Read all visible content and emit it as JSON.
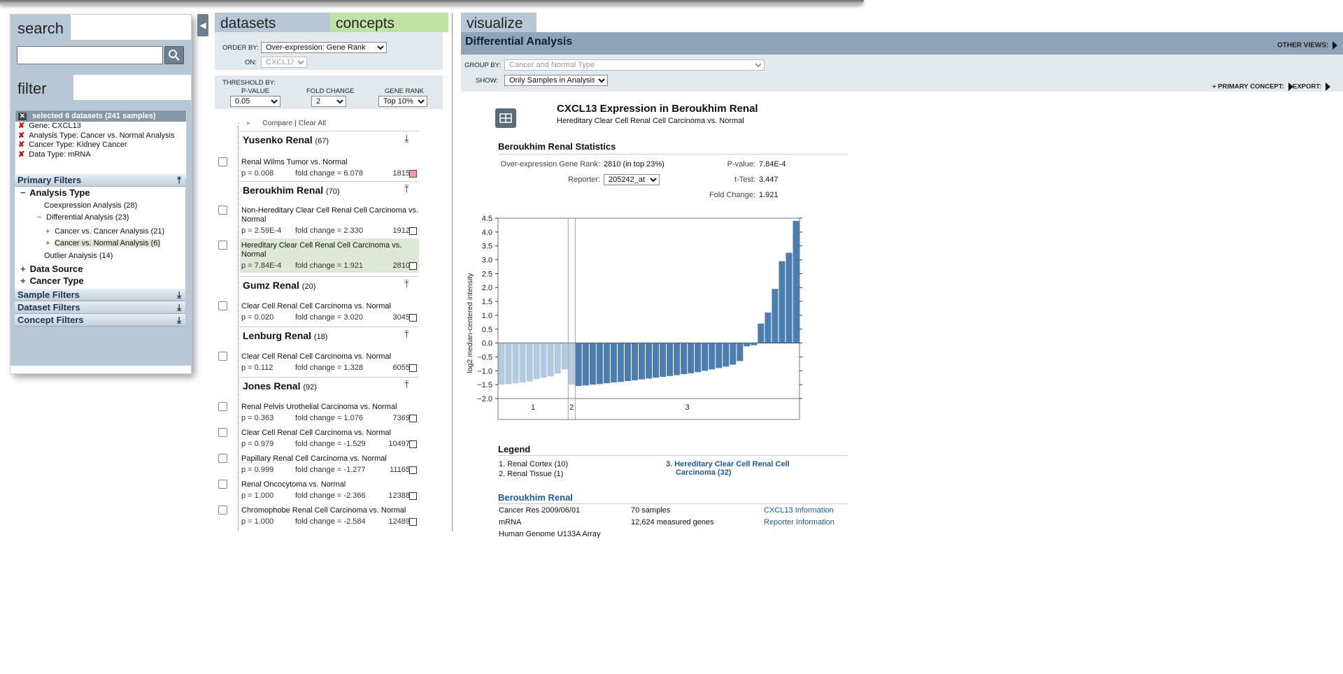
{
  "search": {
    "tab_label": "search",
    "input_value": "",
    "placeholder": ""
  },
  "filter": {
    "tab_label": "filter",
    "selected_header": "selected 6 datasets (241 samples)",
    "selected_items": [
      "Gene: CXCL13",
      "Analysis Type: Cancer vs. Normal Analysis",
      "Cancer Type: Kidney Cancer",
      "Data Type: mRNA"
    ],
    "primary_filters_label": "Primary Filters",
    "analysis_type_label": "Analysis Type",
    "coexpression": "Coexpression Analysis (28)",
    "differential": "Differential Analysis (23)",
    "cancer_vs_cancer": "Cancer vs. Cancer Analysis (21)",
    "cancer_vs_normal": "Cancer vs. Normal Analysis (6)",
    "outlier": "Outlier Analysis (14)",
    "data_source": "Data Source",
    "cancer_type": "Cancer Type",
    "sample_filters": "Sample Filters",
    "dataset_filters": "Dataset Filters",
    "concept_filters": "Concept Filters"
  },
  "middle": {
    "tab_datasets": "datasets",
    "tab_concepts": "concepts",
    "order_by_label": "ORDER BY:",
    "order_by_value": "Over-expression: Gene Rank",
    "on_label": "ON:",
    "on_value": "CXCL13",
    "threshold_label": "THRESHOLD BY:",
    "pvalue_label": "P-VALUE",
    "pvalue_value": "0.05",
    "foldchange_label": "FOLD CHANGE",
    "foldchange_value": "2",
    "generank_label": "GENE RANK",
    "generank_value": "Top 10%",
    "compare_label": "Compare",
    "sep": "|",
    "clear_all_label": "Clear All",
    "groups": [
      {
        "name": "Yusenko Renal",
        "count": "(67)",
        "items": [
          {
            "title": "Renal Wilms Tumor vs. Normal",
            "p": "p = 0.008",
            "fc": "fold change = 6.078",
            "rank": "1815"
          }
        ]
      },
      {
        "name": "Beroukhim Renal",
        "count": "(70)",
        "items": [
          {
            "title": "Non-Hereditary Clear Cell Renal Cell Carcinoma vs. Normal",
            "p": "p = 2.59E-4",
            "fc": "fold change = 2.330",
            "rank": "1912"
          },
          {
            "title": "Hereditary Clear Cell Renal Cell Carcinoma vs. Normal",
            "p": "p = 7.84E-4",
            "fc": "fold change = 1.921",
            "rank": "2810"
          }
        ]
      },
      {
        "name": "Gumz Renal",
        "count": "(20)",
        "items": [
          {
            "title": "Clear Cell Renal Cell Carcinoma vs. Normal",
            "p": "p = 0.020",
            "fc": "fold change = 3.020",
            "rank": "3045"
          }
        ]
      },
      {
        "name": "Lenburg Renal",
        "count": "(18)",
        "items": [
          {
            "title": "Clear Cell Renal Cell Carcinoma vs. Normal",
            "p": "p = 0.112",
            "fc": "fold change = 1.328",
            "rank": "6055"
          }
        ]
      },
      {
        "name": "Jones Renal",
        "count": "(92)",
        "items": [
          {
            "title": "Renal Pelvis Urothelial Carcinoma vs. Normal",
            "p": "p = 0.363",
            "fc": "fold change = 1.076",
            "rank": "7369"
          },
          {
            "title": "Clear Cell Renal Cell Carcinoma vs. Normal",
            "p": "p = 0.979",
            "fc": "fold change = -1.529",
            "rank": "10497"
          },
          {
            "title": "Papillary Renal Cell Carcinoma vs. Normal",
            "p": "p = 0.999",
            "fc": "fold change = -1.277",
            "rank": "11165"
          },
          {
            "title": "Renal Oncocytoma vs. Normal",
            "p": "p = 1.000",
            "fc": "fold change = -2.366",
            "rank": "12388"
          },
          {
            "title": "Chromophobe Renal Cell Carcinoma vs. Normal",
            "p": "p = 1.000",
            "fc": "fold change = -2.584",
            "rank": "12489"
          }
        ]
      }
    ]
  },
  "visualize": {
    "tab_label": "visualize",
    "title": "Differential Analysis",
    "other_views": "OTHER VIEWS:",
    "group_by_label": "GROUP BY:",
    "group_by_value": "Cancer and Normal Type",
    "show_label": "SHOW:",
    "show_value": "Only Samples in Analysis",
    "primary_concept": "+ PRIMARY CONCEPT:",
    "export": "EXPORT:",
    "chart_title": "CXCL13 Expression in Beroukhim Renal",
    "chart_subtitle": "Hereditary Clear Cell Renal Cell Carcinoma vs. Normal",
    "stats_title": "Beroukhim Renal Statistics",
    "gene_rank_label": "Over-expression Gene Rank:",
    "gene_rank_value": "2810 (in top 23%)",
    "reporter_label": "Reporter:",
    "reporter_value": "205242_at",
    "pvalue_label": "P-value:",
    "pvalue_value": "7.84E-4",
    "ttest_label": "t-Test:",
    "ttest_value": "3.447",
    "fold_label": "Fold Change:",
    "fold_value": "1.921",
    "legend_title": "Legend",
    "legend1": "1. Renal Cortex (10)",
    "legend2": "2. Renal Tissue (1)",
    "legend3": "3. Hereditary Clear Cell Renal Cell Carcinoma (32)",
    "info_title": "Beroukhim Renal",
    "info_c1": [
      "Cancer Res 2009/06/01",
      "mRNA",
      "Human Genome U133A Array"
    ],
    "info_c2": [
      "70 samples",
      "12,624 measured genes"
    ],
    "link1": "CXCL13 Information",
    "link2": "Reporter Information",
    "colors": {
      "normal": "#b3cbe0",
      "cancer": "#4a7db0"
    }
  },
  "chart_data": {
    "type": "bar",
    "ylabel": "log2 median-centered intensity",
    "ylim": [
      -2.0,
      4.5
    ],
    "yticks": [
      "4.5",
      "4.0",
      "3.5",
      "3.0",
      "2.5",
      "2.0",
      "1.5",
      "1.0",
      "0.5",
      "0.0",
      "-0.5",
      "-1.0",
      "-1.5",
      "-2.0"
    ],
    "groups": [
      {
        "label": "1",
        "values": [
          -1.5,
          -1.48,
          -1.45,
          -1.42,
          -1.38,
          -1.3,
          -1.25,
          -1.2,
          -1.1,
          -0.95
        ]
      },
      {
        "label": "2",
        "values": [
          -1.5
        ]
      },
      {
        "label": "3",
        "values": [
          -1.55,
          -1.53,
          -1.5,
          -1.48,
          -1.45,
          -1.42,
          -1.4,
          -1.37,
          -1.34,
          -1.31,
          -1.28,
          -1.25,
          -1.22,
          -1.19,
          -1.16,
          -1.12,
          -1.09,
          -1.05,
          -1.0,
          -0.95,
          -0.9,
          -0.85,
          -0.78,
          -0.65,
          -0.12,
          -0.08,
          0.7,
          1.1,
          1.95,
          2.95,
          3.25,
          4.4
        ]
      }
    ]
  }
}
